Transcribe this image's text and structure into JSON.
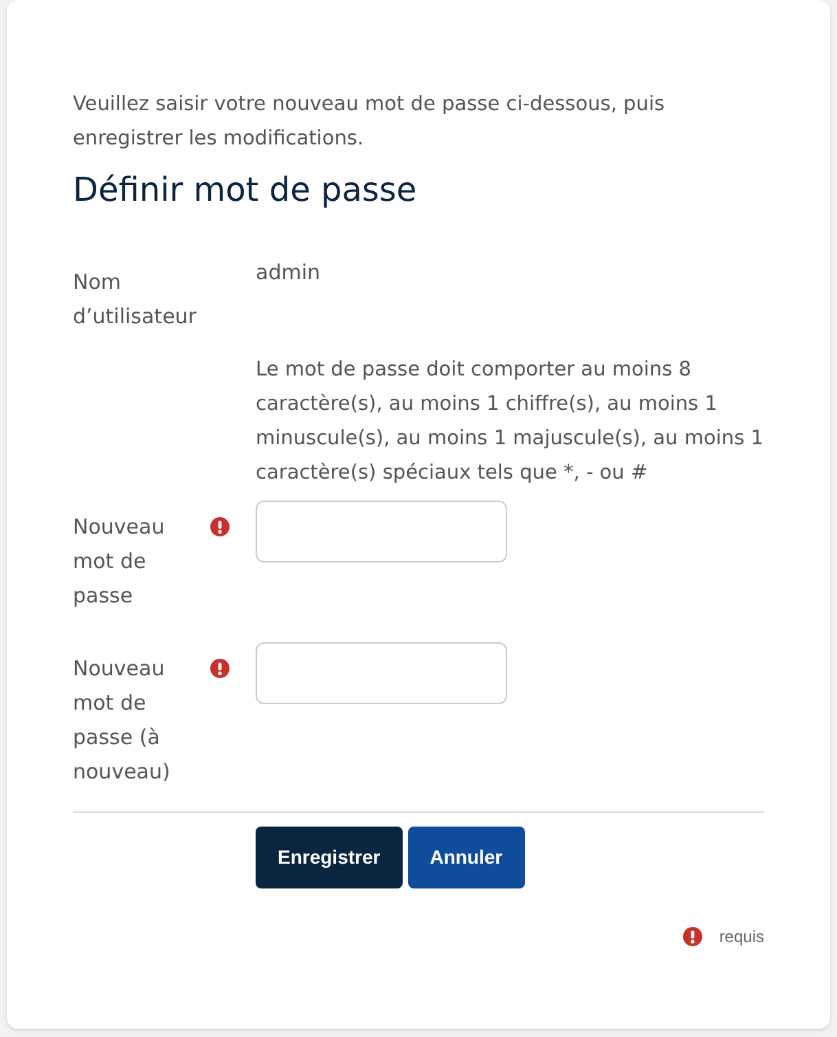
{
  "intro": "Veuillez saisir votre nouveau mot de passe ci-dessous, puis enregistrer les modifications.",
  "heading": "Définir mot de passe",
  "rows": [
    {
      "kind": "static",
      "label": "Nom d’utilisateur",
      "value": "admin"
    },
    {
      "kind": "note",
      "text": "Le mot de passe doit comporter au moins 8 caractère(s), au moins 1 chiffre(s), au moins 1 minuscule(s), au moins 1 majuscule(s), au moins 1 caractère(s) spéciaux tels que *, - ou #"
    },
    {
      "kind": "field",
      "label": "Nouveau mot de passe",
      "required": true
    },
    {
      "kind": "field",
      "label": "Nouveau mot de passe (à nouveau)",
      "required": true
    }
  ],
  "buttons": [
    {
      "label": "Enregistrer",
      "kind": "primary"
    },
    {
      "label": "Annuler",
      "kind": "secondary"
    }
  ],
  "required_legend": "requis"
}
